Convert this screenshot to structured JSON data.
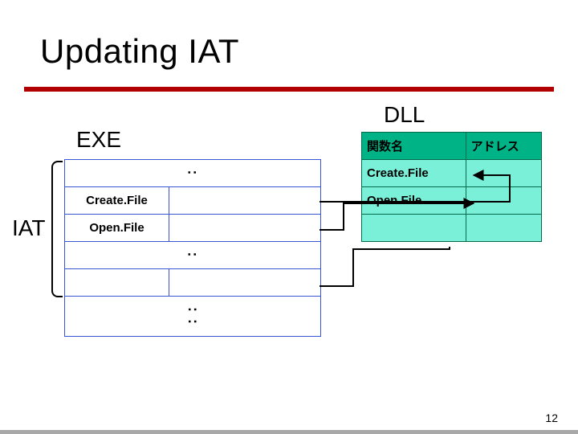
{
  "title": "Updating IAT",
  "labels": {
    "exe": "EXE",
    "dll": "DLL",
    "iat": "IAT"
  },
  "exe_table": {
    "dots1": ":",
    "row_create": "Create.File",
    "row_open": "Open.File",
    "dots2": ":",
    "dots3": ": :"
  },
  "dll_table": {
    "header_name": "関数名",
    "header_addr": "アドレス",
    "row1_name": "Create.File",
    "row2_name": "Open.File"
  },
  "slide_number": "12",
  "colors": {
    "rule": "#b00000",
    "exe_border": "#3a55d4",
    "dll_border": "#006a4b",
    "dll_head_bg": "#00b386",
    "dll_body_bg": "#7af0d8"
  }
}
